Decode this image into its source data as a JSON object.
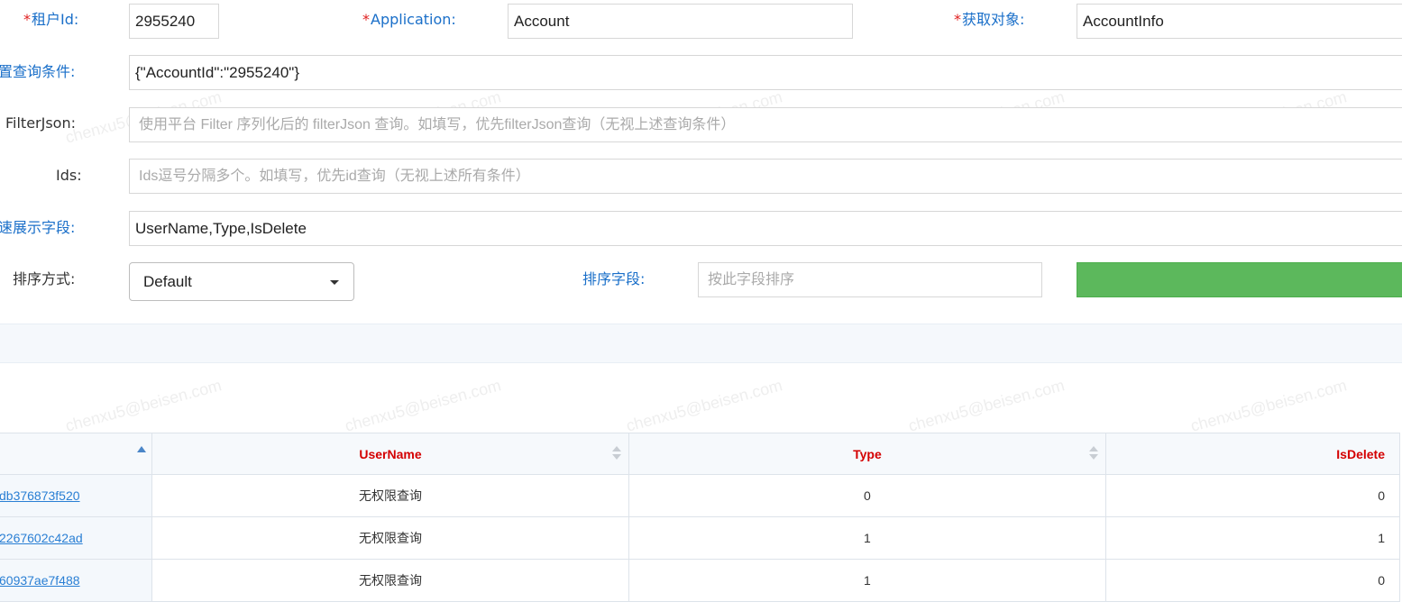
{
  "form": {
    "tenant_id": {
      "label": "租户Id:",
      "value": "2955240"
    },
    "application": {
      "label": "Application:",
      "value": "Account"
    },
    "fetch_object": {
      "label": "获取对象:",
      "value": "AccountInfo"
    },
    "preset_query": {
      "label": "置查询条件:",
      "value": "{\"AccountId\":\"2955240\"}"
    },
    "filter_json": {
      "label": "FilterJson:",
      "placeholder": "使用平台 Filter 序列化后的 filterJson 查询。如填写，优先filterJson查询（无视上述查询条件）"
    },
    "ids": {
      "label": "Ids:",
      "placeholder": "Ids逗号分隔多个。如填写，优先id查询（无视上述所有条件）"
    },
    "display_fields": {
      "label": "速展示字段:",
      "value": "UserName,Type,IsDelete"
    },
    "sort_mode": {
      "label": "排序方式:",
      "value": "Default"
    },
    "sort_field": {
      "label": "排序字段:",
      "placeholder": "按此字段排序"
    }
  },
  "watermark": "chenxu5@beisen.com",
  "table": {
    "columns": [
      "",
      "UserName",
      "Type",
      "IsDelete"
    ],
    "rows": [
      {
        "id": "db376873f520",
        "username": "无权限查询",
        "type": "0",
        "isdelete": "0"
      },
      {
        "id": "2267602c42ad",
        "username": "无权限查询",
        "type": "1",
        "isdelete": "1"
      },
      {
        "id": "60937ae7f488",
        "username": "无权限查询",
        "type": "1",
        "isdelete": "0"
      }
    ]
  },
  "colors": {
    "label_blue": "#1a6fc9",
    "required_red": "#e02020",
    "button_green": "#5cb85c",
    "header_red": "#d40000",
    "link_blue": "#2a7fd4"
  }
}
